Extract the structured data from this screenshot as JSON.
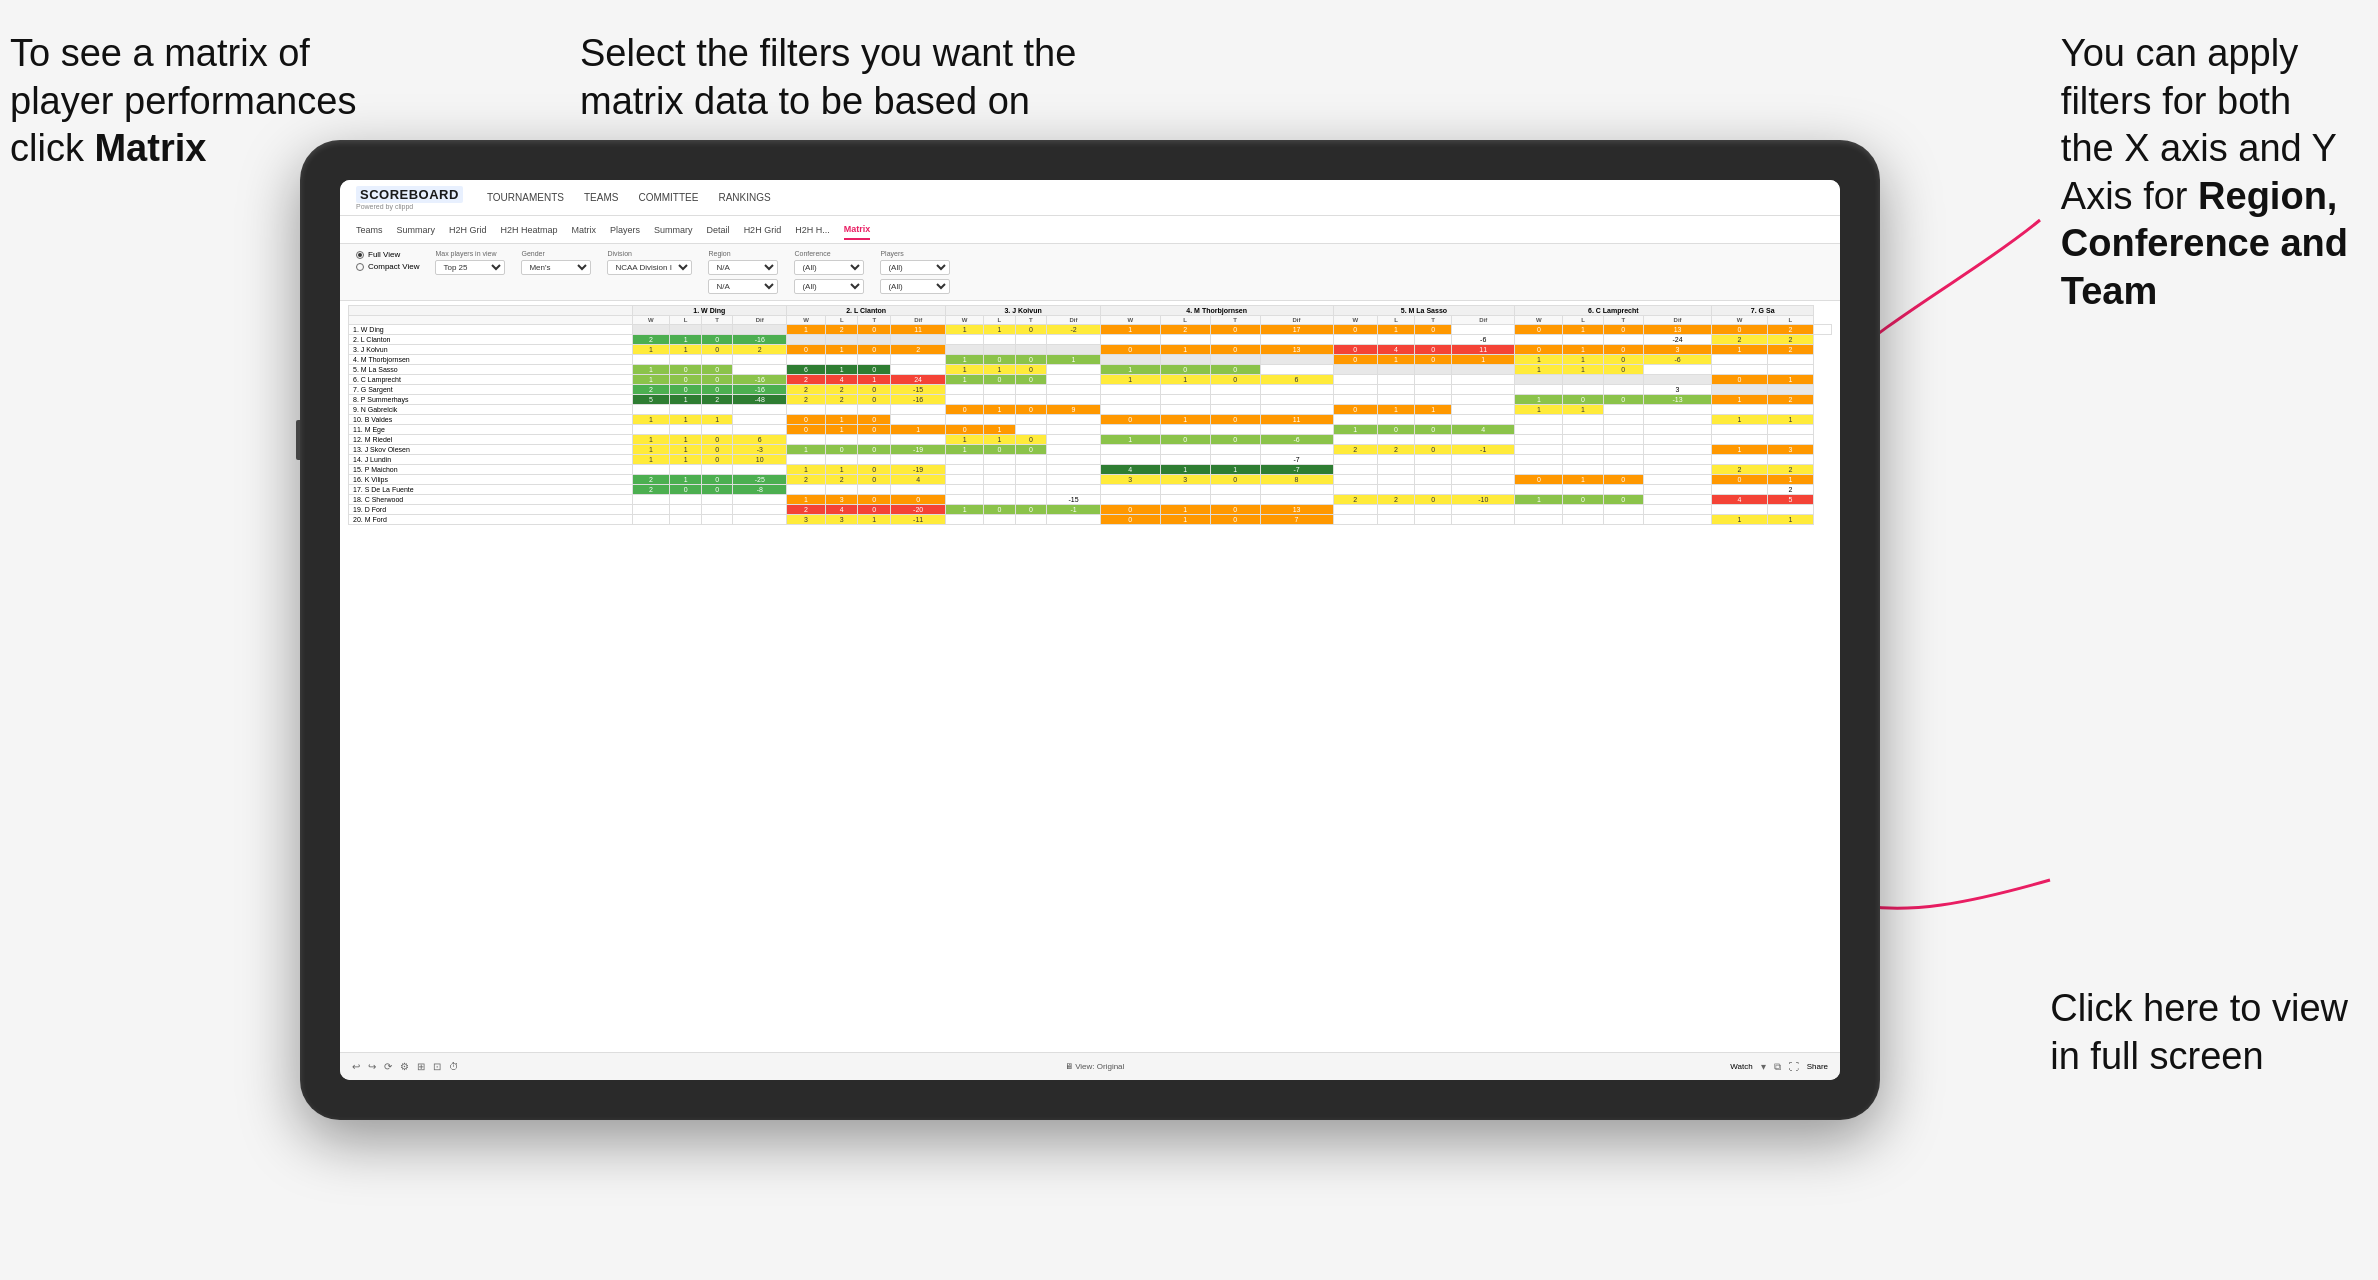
{
  "annotations": {
    "top_left": {
      "line1": "To see a matrix of",
      "line2": "player performances",
      "line3_plain": "click ",
      "line3_bold": "Matrix"
    },
    "top_center": {
      "text": "Select the filters you want the matrix data to be based on"
    },
    "top_right": {
      "line1": "You  can apply",
      "line2": "filters for both",
      "line3": "the X axis and Y",
      "line4_plain": "Axis for ",
      "line4_bold": "Region,",
      "line5_bold": "Conference and",
      "line6_bold": "Team"
    },
    "bottom_right": {
      "line1": "Click here to view",
      "line2": "in full screen"
    }
  },
  "nav": {
    "logo": "SCOREBOARD",
    "logo_sub": "Powered by clippd",
    "items": [
      "TOURNAMENTS",
      "TEAMS",
      "COMMITTEE",
      "RANKINGS"
    ]
  },
  "secondary_nav": {
    "items": [
      "Teams",
      "Summary",
      "H2H Grid",
      "H2H Heatmap",
      "Matrix",
      "Players",
      "Summary",
      "Detail",
      "H2H Grid",
      "H2H H...",
      "Matrix"
    ],
    "active": "Matrix"
  },
  "filters": {
    "view_options": [
      "Full View",
      "Compact View"
    ],
    "active_view": "Full View",
    "max_players_label": "Max players in view",
    "max_players_value": "Top 25",
    "gender_label": "Gender",
    "gender_value": "Men's",
    "division_label": "Division",
    "division_value": "NCAA Division I",
    "region_label": "Region",
    "region_value": "N/A",
    "region_value2": "N/A",
    "conference_label": "Conference",
    "conference_value": "(All)",
    "conference_value2": "(All)",
    "players_label": "Players",
    "players_value": "(All)",
    "players_value2": "(All)"
  },
  "matrix_headers": {
    "columns": [
      {
        "name": "1. W Ding",
        "cols": [
          "W",
          "L",
          "T",
          "Dif"
        ]
      },
      {
        "name": "2. L Clanton",
        "cols": [
          "W",
          "L",
          "T",
          "Dif"
        ]
      },
      {
        "name": "3. J Koivun",
        "cols": [
          "W",
          "L",
          "T",
          "Dif"
        ]
      },
      {
        "name": "4. M Thorbjornsen",
        "cols": [
          "W",
          "L",
          "T",
          "Dif"
        ]
      },
      {
        "name": "5. M La Sasso",
        "cols": [
          "W",
          "L",
          "T",
          "Dif"
        ]
      },
      {
        "name": "6. C Lamprecht",
        "cols": [
          "W",
          "L",
          "T",
          "Dif"
        ]
      },
      {
        "name": "7. G Sa",
        "cols": [
          "W",
          "L"
        ]
      }
    ]
  },
  "matrix_rows": [
    {
      "name": "1. W Ding",
      "data": [
        [
          null,
          null,
          null,
          null
        ],
        [
          1,
          2,
          0,
          11
        ],
        [
          1,
          1,
          0,
          -2
        ],
        [
          1,
          2,
          0,
          17
        ],
        [
          0,
          1,
          0,
          null
        ],
        [
          0,
          1,
          0,
          13
        ],
        [
          0,
          2,
          null
        ]
      ]
    },
    {
      "name": "2. L Clanton",
      "data": [
        [
          2,
          1,
          0,
          -16
        ],
        [
          null,
          null,
          null,
          null
        ],
        [
          null,
          null,
          null,
          null
        ],
        [
          null,
          null,
          null,
          null
        ],
        [
          null,
          null,
          null,
          -6
        ],
        [
          null,
          null,
          null,
          -24
        ],
        [
          2,
          2
        ]
      ]
    },
    {
      "name": "3. J Kolvun",
      "data": [
        [
          1,
          1,
          0,
          2
        ],
        [
          0,
          1,
          0,
          2
        ],
        [
          null,
          null,
          null,
          null
        ],
        [
          0,
          1,
          0,
          13
        ],
        [
          0,
          4,
          0,
          11
        ],
        [
          0,
          1,
          0,
          3
        ],
        [
          1,
          2
        ]
      ]
    },
    {
      "name": "4. M Thorbjornsen",
      "data": [
        [
          null,
          null,
          null,
          null
        ],
        [
          null,
          null,
          null,
          null
        ],
        [
          1,
          0,
          0,
          1
        ],
        [
          null,
          null,
          null,
          null
        ],
        [
          0,
          1,
          0,
          1
        ],
        [
          1,
          1,
          0,
          -6
        ],
        [
          null,
          null
        ]
      ]
    },
    {
      "name": "5. M La Sasso",
      "data": [
        [
          1,
          0,
          0,
          null
        ],
        [
          6,
          1,
          0,
          null
        ],
        [
          1,
          1,
          0,
          null
        ],
        [
          1,
          0,
          0,
          null
        ],
        [
          null,
          null,
          null,
          null
        ],
        [
          1,
          1,
          0,
          null
        ],
        [
          null,
          null
        ]
      ]
    },
    {
      "name": "6. C Lamprecht",
      "data": [
        [
          1,
          0,
          0,
          -16
        ],
        [
          2,
          4,
          1,
          24
        ],
        [
          1,
          0,
          0,
          null
        ],
        [
          1,
          1,
          0,
          6
        ],
        [
          null,
          null,
          null,
          null
        ],
        [
          null,
          null,
          null,
          null
        ],
        [
          0,
          1
        ]
      ]
    },
    {
      "name": "7. G Sargent",
      "data": [
        [
          2,
          0,
          0,
          -16
        ],
        [
          2,
          2,
          0,
          -15
        ],
        [
          null,
          null,
          null,
          null
        ],
        [
          null,
          null,
          null,
          null
        ],
        [
          null,
          null,
          null,
          null
        ],
        [
          null,
          null,
          null,
          3
        ],
        [
          null,
          null
        ]
      ]
    },
    {
      "name": "8. P Summerhays",
      "data": [
        [
          5,
          1,
          2,
          -48
        ],
        [
          2,
          2,
          0,
          -16
        ],
        [
          null,
          null,
          null,
          null
        ],
        [
          null,
          null,
          null,
          null
        ],
        [
          null,
          null,
          null,
          null
        ],
        [
          1,
          0,
          0,
          -13
        ],
        [
          1,
          2
        ]
      ]
    },
    {
      "name": "9. N Gabrelcik",
      "data": [
        [
          null,
          null,
          null,
          null
        ],
        [
          null,
          null,
          null,
          null
        ],
        [
          0,
          1,
          0,
          9
        ],
        [
          null,
          null,
          null,
          null
        ],
        [
          0,
          1,
          1,
          null
        ],
        [
          1,
          1,
          null,
          null
        ],
        [
          null,
          null
        ]
      ]
    },
    {
      "name": "10. B Valdes",
      "data": [
        [
          1,
          1,
          1,
          null
        ],
        [
          0,
          1,
          0,
          null
        ],
        [
          null,
          null,
          null,
          null
        ],
        [
          0,
          1,
          0,
          11
        ],
        [
          null,
          null,
          null,
          null
        ],
        [
          null,
          null,
          null,
          null
        ],
        [
          1,
          1
        ]
      ]
    },
    {
      "name": "11. M Ege",
      "data": [
        [
          null,
          null,
          null,
          null
        ],
        [
          0,
          1,
          0,
          1
        ],
        [
          0,
          1,
          null,
          null
        ],
        [
          null,
          null,
          null,
          null
        ],
        [
          1,
          0,
          0,
          4
        ],
        [
          null,
          null,
          null,
          null
        ],
        [
          null,
          null
        ]
      ]
    },
    {
      "name": "12. M Riedel",
      "data": [
        [
          1,
          1,
          0,
          6
        ],
        [
          null,
          null,
          null,
          null
        ],
        [
          1,
          1,
          0,
          null
        ],
        [
          1,
          0,
          0,
          -6
        ],
        [
          null,
          null,
          null,
          null
        ],
        [
          null,
          null,
          null,
          null
        ],
        [
          null,
          null
        ]
      ]
    },
    {
      "name": "13. J Skov Olesen",
      "data": [
        [
          1,
          1,
          0,
          -3
        ],
        [
          1,
          0,
          0,
          -19
        ],
        [
          1,
          0,
          0,
          null
        ],
        [
          null,
          null,
          null,
          null
        ],
        [
          2,
          2,
          0,
          -1
        ],
        [
          null,
          null,
          null,
          null
        ],
        [
          1,
          3
        ]
      ]
    },
    {
      "name": "14. J Lundin",
      "data": [
        [
          1,
          1,
          0,
          10
        ],
        [
          null,
          null,
          null,
          null
        ],
        [
          null,
          null,
          null,
          null
        ],
        [
          null,
          null,
          null,
          -7
        ],
        [
          null,
          null,
          null,
          null
        ],
        [
          null,
          null,
          null,
          null
        ],
        [
          null,
          null
        ]
      ]
    },
    {
      "name": "15. P Maichon",
      "data": [
        [
          null,
          null,
          null,
          null
        ],
        [
          1,
          1,
          0,
          -19
        ],
        [
          null,
          null,
          null,
          null
        ],
        [
          4,
          1,
          1,
          -7
        ],
        [
          null,
          null,
          null,
          null
        ],
        [
          null,
          null,
          null,
          null
        ],
        [
          2,
          2
        ]
      ]
    },
    {
      "name": "16. K Vilips",
      "data": [
        [
          2,
          1,
          0,
          -25
        ],
        [
          2,
          2,
          0,
          4
        ],
        [
          null,
          null,
          null,
          null
        ],
        [
          3,
          3,
          0,
          8
        ],
        [
          null,
          null,
          null,
          null
        ],
        [
          0,
          1,
          0,
          null
        ],
        [
          0,
          1
        ]
      ]
    },
    {
      "name": "17. S De La Fuente",
      "data": [
        [
          2,
          0,
          0,
          -8
        ],
        [
          null,
          null,
          null,
          null
        ],
        [
          null,
          null,
          null,
          null
        ],
        [
          null,
          null,
          null,
          null
        ],
        [
          null,
          null,
          null,
          null
        ],
        [
          null,
          null,
          null,
          null
        ],
        [
          null,
          2
        ]
      ]
    },
    {
      "name": "18. C Sherwood",
      "data": [
        [
          null,
          null,
          null,
          null
        ],
        [
          1,
          3,
          0,
          0
        ],
        [
          null,
          null,
          null,
          -15
        ],
        [
          null,
          null,
          null,
          null
        ],
        [
          2,
          2,
          0,
          -10
        ],
        [
          1,
          0,
          0,
          null
        ],
        [
          4,
          5
        ]
      ]
    },
    {
      "name": "19. D Ford",
      "data": [
        [
          null,
          null,
          null,
          null
        ],
        [
          2,
          4,
          0,
          -20
        ],
        [
          1,
          0,
          0,
          -1
        ],
        [
          0,
          1,
          0,
          13
        ],
        [
          null,
          null,
          null,
          null
        ],
        [
          null,
          null,
          null,
          null
        ],
        [
          null,
          null
        ]
      ]
    },
    {
      "name": "20. M Ford",
      "data": [
        [
          null,
          null,
          null,
          null
        ],
        [
          3,
          3,
          1,
          -11
        ],
        [
          null,
          null,
          null,
          null
        ],
        [
          0,
          1,
          0,
          7
        ],
        [
          null,
          null,
          null,
          null
        ],
        [
          null,
          null,
          null,
          null
        ],
        [
          1,
          1
        ]
      ]
    }
  ],
  "bottom_toolbar": {
    "view_label": "View: Original",
    "watch_label": "Watch",
    "share_label": "Share"
  }
}
